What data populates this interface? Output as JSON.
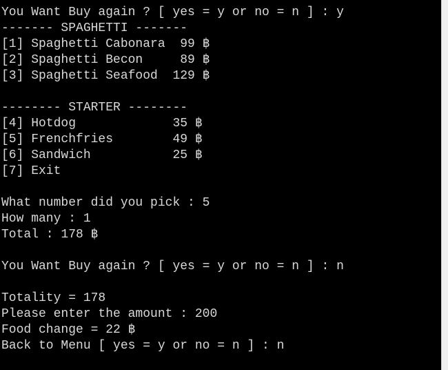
{
  "console": {
    "lines": [
      "You Want Buy again ? [ yes = y or no = n ] : y",
      "------- SPAGHETTI -------",
      "[1] Spaghetti Cabonara  99 ฿",
      "[2] Spaghetti Becon     89 ฿",
      "[3] Spaghetti Seafood  129 ฿",
      "",
      "-------- STARTER --------",
      "[4] Hotdog             35 ฿",
      "[5] Frenchfries        49 ฿",
      "[6] Sandwich           25 ฿",
      "[7] Exit",
      "",
      "What number did you pick : 5",
      "How many : 1",
      "Total : 178 ฿",
      "",
      "You Want Buy again ? [ yes = y or no = n ] : n",
      "",
      "Totality = 178",
      "Please enter the amount : 200",
      "Food change = 22 ฿",
      "Back to Menu [ yes = y or no = n ] : n"
    ]
  },
  "colors": {
    "background": "#000000",
    "text": "#d9d9d9",
    "scrollbar": "#f0f0f0"
  }
}
